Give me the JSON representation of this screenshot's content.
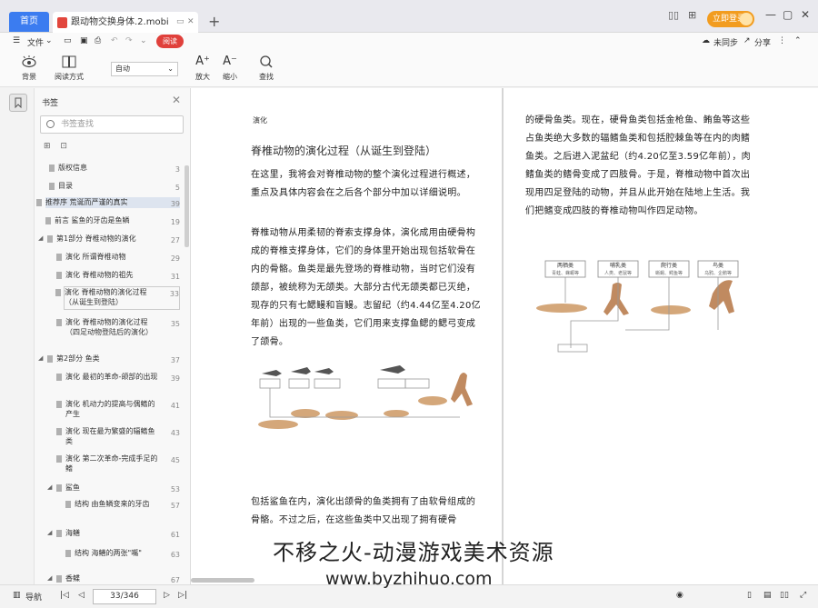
{
  "titlebar": {
    "home_tab": "首页",
    "doc_tab": "跟动物交换身体.2.mobi",
    "login_label": "立即登录"
  },
  "menubar": {
    "menu_label": "文件",
    "badge": "阅读"
  },
  "sync": {
    "unsynced": "未同步",
    "share": "分享"
  },
  "toolbar": {
    "background": "背景",
    "read_mode": "阅读方式",
    "zoom_select": "自动",
    "zoom_in": "放大",
    "zoom_out": "缩小",
    "find": "查找"
  },
  "sidebar": {
    "title": "书签",
    "search_placeholder": "书签查找",
    "items": [
      {
        "label": "版权信息",
        "page": "3"
      },
      {
        "label": "目录",
        "page": "5"
      },
      {
        "label": "推荐序 荒诞而严谨的真实",
        "page": "39"
      },
      {
        "label": "前言 鲨鱼的牙齿是鱼鳞",
        "page": "19"
      },
      {
        "label": "第1部分 脊椎动物的演化",
        "page": "27"
      },
      {
        "label": "演化 所谓脊椎动物",
        "page": "29"
      },
      {
        "label": "演化 脊椎动物的祖先",
        "page": "31"
      },
      {
        "label": "演化 脊椎动物的演化过程（从诞生到登陆）",
        "page": "33"
      },
      {
        "label": "演化 脊椎动物的演化过程（四足动物登陆后的演化）",
        "page": "35"
      },
      {
        "label": "第2部分 鱼类",
        "page": "37"
      },
      {
        "label": "演化 最初的革命-颌部的出现",
        "page": "39"
      },
      {
        "label": "演化 机动力的提高与偶鳍的产生",
        "page": "41"
      },
      {
        "label": "演化 现在最为繁盛的辐鳍鱼类",
        "page": "43"
      },
      {
        "label": "演化 第二次革命-完成手足的鳍",
        "page": "45"
      },
      {
        "label": "鲨鱼",
        "page": "53"
      },
      {
        "label": "结构 由鱼鳞变来的牙齿",
        "page": "57"
      },
      {
        "label": "海鳝",
        "page": "61"
      },
      {
        "label": "结构 海鳝的两张\"嘴\"",
        "page": "63"
      },
      {
        "label": "香鲽",
        "page": "67"
      }
    ]
  },
  "page_left": {
    "header": "演化",
    "title": "脊椎动物的演化过程（从诞生到登陆）",
    "para1": "在这里，我将会对脊椎动物的整个演化过程进行概述，重点及具体内容会在之后各个部分中加以详细说明。",
    "para2": "脊椎动物从用柔韧的脊索支撑身体，演化成用由硬骨构成的脊椎支撑身体，它们的身体里开始出现包括软骨在内的骨骼。鱼类是最先登场的脊椎动物，当时它们没有颌部，被统称为无颌类。大部分古代无颌类都已灭绝，现存的只有七鳃鳗和盲鳗。志留纪（约4.44亿至4.20亿年前）出现的一些鱼类，它们用来支撑鱼鳃的鳃弓变成了颌骨。",
    "para3": "包括鲨鱼在内，演化出颌骨的鱼类拥有了由软骨组成的骨骼。不过之后，在这些鱼类中又出现了拥有硬骨"
  },
  "page_right": {
    "para1": "的硬骨鱼类。现在，硬骨鱼类包括金枪鱼、鲔鱼等这些占鱼类绝大多数的辐鳍鱼类和包括腔棘鱼等在内的肉鳍鱼类。之后进入泥盆纪（约4.20亿至3.59亿年前），肉鳍鱼类的鳍骨变成了四肢骨。于是，脊椎动物中首次出现用四足登陆的动物，并且从此开始在陆地上生活。我们把鳍变成四肢的脊椎动物叫作四足动物。",
    "fig_labels": [
      "两栖类",
      "哺乳类",
      "爬行类",
      "鸟类"
    ],
    "fig_sub": [
      "青蛙、蝾螈等",
      "人类、老鼠等",
      "蜥蜴、鳄鱼等",
      "乌鸦、企鹅等"
    ]
  },
  "status": {
    "nav": "导航",
    "page_indicator": "33/346"
  },
  "watermark": {
    "line1": "不移之火-动漫游戏美术资源",
    "line2": "www.byzhihuo.com"
  }
}
